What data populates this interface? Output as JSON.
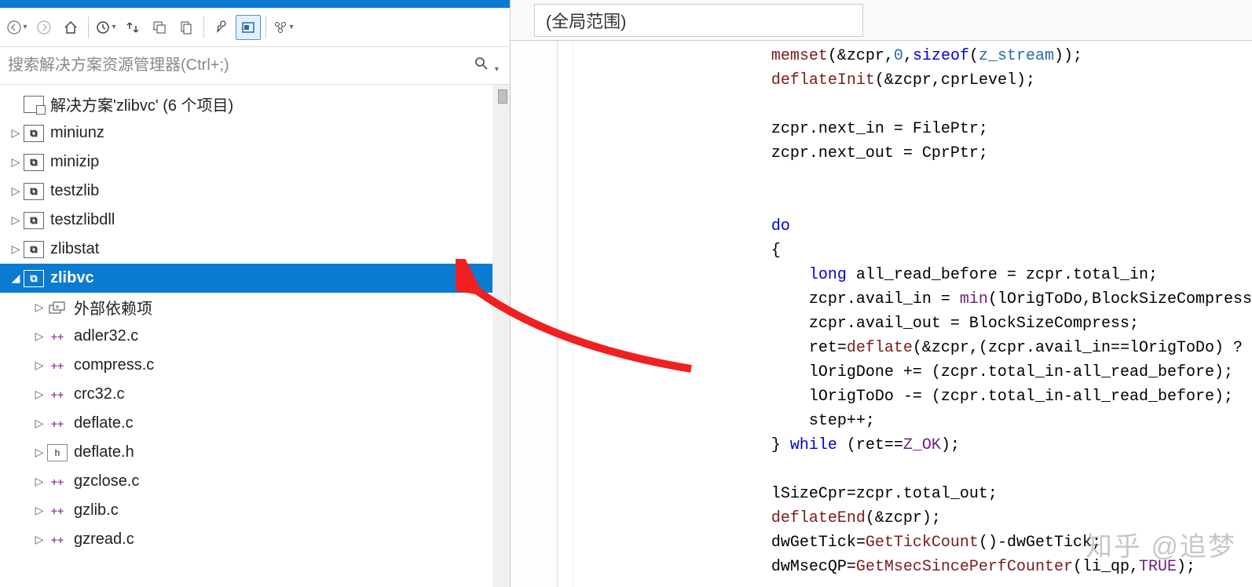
{
  "solution": {
    "label": "解决方案'zlibvc' (6 个项目)",
    "projects": [
      {
        "name": "miniunz",
        "expanded": false,
        "selected": false
      },
      {
        "name": "minizip",
        "expanded": false,
        "selected": false
      },
      {
        "name": "testzlib",
        "expanded": false,
        "selected": false
      },
      {
        "name": "testzlibdll",
        "expanded": false,
        "selected": false
      },
      {
        "name": "zlibstat",
        "expanded": false,
        "selected": false
      },
      {
        "name": "zlibvc",
        "expanded": true,
        "selected": true
      }
    ]
  },
  "zlibvc_items": {
    "deps": "外部依赖项",
    "files": [
      {
        "name": "adler32.c",
        "kind": "cpp"
      },
      {
        "name": "compress.c",
        "kind": "cpp"
      },
      {
        "name": "crc32.c",
        "kind": "cpp"
      },
      {
        "name": "deflate.c",
        "kind": "cpp"
      },
      {
        "name": "deflate.h",
        "kind": "h"
      },
      {
        "name": "gzclose.c",
        "kind": "cpp"
      },
      {
        "name": "gzlib.c",
        "kind": "cpp"
      },
      {
        "name": "gzread.c",
        "kind": "cpp"
      }
    ]
  },
  "search": {
    "placeholder": "搜索解决方案资源管理器(Ctrl+;)"
  },
  "scope": {
    "label": "(全局范围)"
  },
  "code_lines": [
    {
      "indent": 3,
      "tokens": [
        {
          "t": "memset",
          "c": "fn"
        },
        {
          "t": "(&zcpr,"
        },
        {
          "t": "0",
          "c": "ty"
        },
        {
          "t": ","
        },
        {
          "t": "sizeof",
          "c": "kw"
        },
        {
          "t": "("
        },
        {
          "t": "z_stream",
          "c": "ty"
        },
        {
          "t": "));"
        }
      ]
    },
    {
      "indent": 3,
      "tokens": [
        {
          "t": "deflateInit",
          "c": "fn"
        },
        {
          "t": "(&zcpr,cprLevel);"
        }
      ]
    },
    {
      "indent": 0,
      "tokens": []
    },
    {
      "indent": 3,
      "tokens": [
        {
          "t": "zcpr.next_in = FilePtr;"
        }
      ]
    },
    {
      "indent": 3,
      "tokens": [
        {
          "t": "zcpr.next_out = CprPtr;"
        }
      ]
    },
    {
      "indent": 0,
      "tokens": []
    },
    {
      "indent": 0,
      "tokens": []
    },
    {
      "indent": 3,
      "tokens": [
        {
          "t": "do",
          "c": "kw"
        }
      ]
    },
    {
      "indent": 3,
      "tokens": [
        {
          "t": "{"
        }
      ]
    },
    {
      "indent": 4,
      "tokens": [
        {
          "t": "long ",
          "c": "kw"
        },
        {
          "t": "all_read_before = zcpr.total_in;"
        }
      ]
    },
    {
      "indent": 4,
      "tokens": [
        {
          "t": "zcpr.avail_in = "
        },
        {
          "t": "min",
          "c": "mac"
        },
        {
          "t": "(lOrigToDo,BlockSizeCompress"
        }
      ]
    },
    {
      "indent": 4,
      "tokens": [
        {
          "t": "zcpr.avail_out = BlockSizeCompress;"
        }
      ]
    },
    {
      "indent": 4,
      "tokens": [
        {
          "t": "ret="
        },
        {
          "t": "deflate",
          "c": "fn"
        },
        {
          "t": "(&zcpr,(zcpr.avail_in==lOrigToDo) ?"
        }
      ]
    },
    {
      "indent": 4,
      "tokens": [
        {
          "t": "lOrigDone += (zcpr.total_in-all_read_before);"
        }
      ]
    },
    {
      "indent": 4,
      "tokens": [
        {
          "t": "lOrigToDo -= (zcpr.total_in-all_read_before);"
        }
      ]
    },
    {
      "indent": 4,
      "tokens": [
        {
          "t": "step++;"
        }
      ]
    },
    {
      "indent": 3,
      "tokens": [
        {
          "t": "} "
        },
        {
          "t": "while ",
          "c": "kw"
        },
        {
          "t": "(ret=="
        },
        {
          "t": "Z_OK",
          "c": "mac"
        },
        {
          "t": ");"
        }
      ]
    },
    {
      "indent": 0,
      "tokens": []
    },
    {
      "indent": 3,
      "tokens": [
        {
          "t": "lSizeCpr=zcpr.total_out;"
        }
      ]
    },
    {
      "indent": 3,
      "tokens": [
        {
          "t": "deflateEnd",
          "c": "fn"
        },
        {
          "t": "(&zcpr);"
        }
      ]
    },
    {
      "indent": 3,
      "tokens": [
        {
          "t": "dwGetTick="
        },
        {
          "t": "GetTickCount",
          "c": "fn"
        },
        {
          "t": "()-dwGetTick;"
        }
      ]
    },
    {
      "indent": 3,
      "tokens": [
        {
          "t": "dwMsecQP="
        },
        {
          "t": "GetMsecSincePerfCounter",
          "c": "fn"
        },
        {
          "t": "(li_qp,"
        },
        {
          "t": "TRUE",
          "c": "mac"
        },
        {
          "t": ");"
        }
      ]
    }
  ],
  "watermark": "知乎 @追梦"
}
